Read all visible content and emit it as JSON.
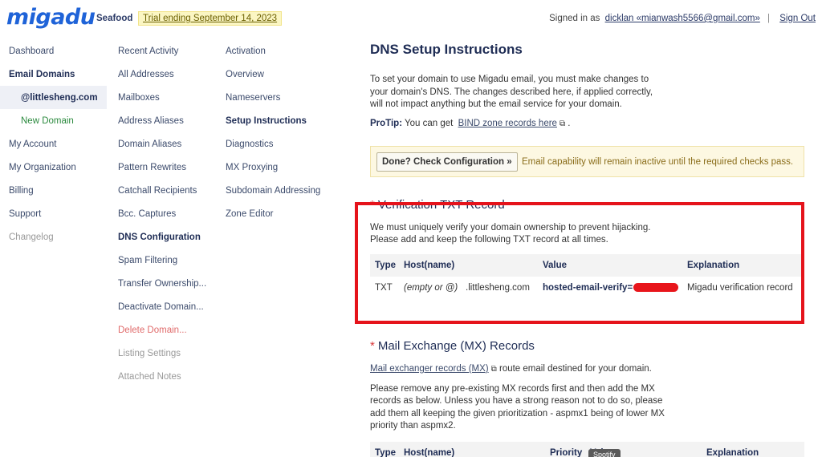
{
  "header": {
    "logo": "migadu",
    "org": "Seafood",
    "trial": "Trial ending September 14, 2023",
    "signed_in_as": "Signed in as",
    "user": "dicklan «mianwash5566@gmail.com»",
    "sign_out": "Sign Out"
  },
  "nav": {
    "col1": [
      "Dashboard",
      "Email Domains",
      "@littlesheng.com",
      "New Domain",
      "My Account",
      "My Organization",
      "Billing",
      "Support",
      "Changelog"
    ],
    "col2": [
      "Recent Activity",
      "All Addresses",
      "Mailboxes",
      "Address Aliases",
      "Domain Aliases",
      "Pattern Rewrites",
      "Catchall Recipients",
      "Bcc. Captures",
      "DNS Configuration",
      "Spam Filtering",
      "Transfer Ownership...",
      "Deactivate Domain...",
      "Delete Domain...",
      "Listing Settings",
      "Attached Notes"
    ],
    "col3": [
      "Activation",
      "Overview",
      "Nameservers",
      "Setup Instructions",
      "Diagnostics",
      "MX Proxying",
      "Subdomain Addressing",
      "Zone Editor"
    ]
  },
  "main": {
    "title": "DNS Setup Instructions",
    "intro": "To set your domain to use Migadu email, you must make changes to your domain's DNS. The changes described here, if applied correctly, will not impact anything but the email service for your domain.",
    "protip_label": "ProTip:",
    "protip_text": "You can get",
    "protip_link": "BIND zone records here",
    "protip_end": ".",
    "check_button": "Done? Check Configuration »",
    "check_note": "Email capability will remain inactive until the required checks pass.",
    "txt": {
      "title": "Verification TXT Record",
      "desc1": "We must uniquely verify your domain ownership to prevent hijacking.",
      "desc2": "Please add and keep the following TXT record at all times.",
      "headers": [
        "Type",
        "Host(name)",
        "",
        "Value",
        "Explanation"
      ],
      "row": {
        "type": "TXT",
        "host": "(empty or @)",
        "domain": ".littlesheng.com",
        "value": "hosted-email-verify=",
        "explanation": "Migadu verification record"
      }
    },
    "mx": {
      "title": "Mail Exchange (MX) Records",
      "link": "Mail exchanger records (MX)",
      "link_rest": "route email destined for your domain.",
      "desc": "Please remove any pre-existing MX records first and then add the MX records as below. Unless you have a strong reason not to do so, please add them all keeping the given prioritization - aspmx1 being of lower MX priority than aspmx2.",
      "headers": [
        "Type",
        "Host(name)",
        "Priority",
        "Value",
        "Explanation"
      ]
    }
  },
  "tooltip": "Spotify",
  "colors": {
    "brand": "#1f63d8",
    "highlight": "#e5131b"
  }
}
